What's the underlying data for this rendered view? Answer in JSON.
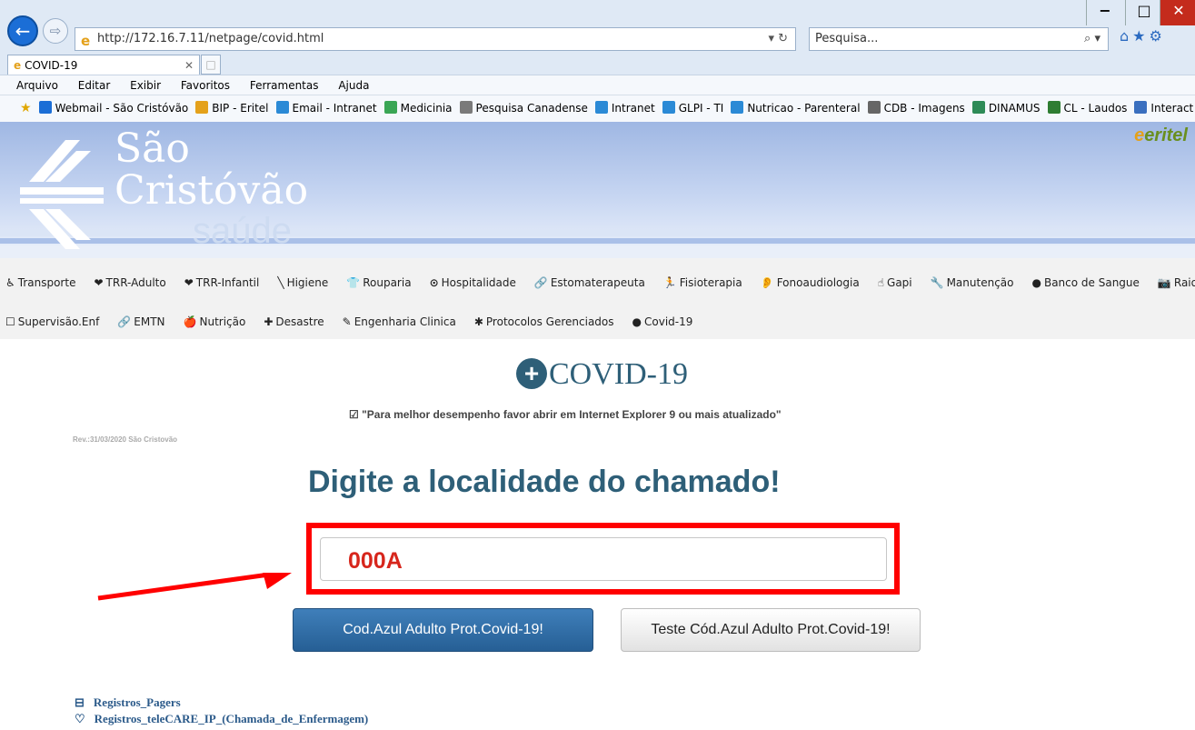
{
  "browser": {
    "url": "http://172.16.7.11/netpage/covid.html",
    "search_placeholder": "Pesquisa...",
    "tab_title": "COVID-19",
    "menu": [
      "Arquivo",
      "Editar",
      "Exibir",
      "Favoritos",
      "Ferramentas",
      "Ajuda"
    ],
    "favorites": [
      {
        "label": "Webmail - São Cristóvão",
        "color": "#1b6ed6"
      },
      {
        "label": "BIP - Eritel",
        "color": "#e4a11b"
      },
      {
        "label": "Email - Intranet",
        "color": "#2b8ad6"
      },
      {
        "label": "Medicinia",
        "color": "#3aa655"
      },
      {
        "label": "Pesquisa Canadense",
        "color": "#7a7a7a"
      },
      {
        "label": "Intranet",
        "color": "#2b8ad6"
      },
      {
        "label": "GLPI - TI",
        "color": "#2b8ad6"
      },
      {
        "label": "Nutricao - Parenteral",
        "color": "#2b8ad6"
      },
      {
        "label": "CDB - Imagens",
        "color": "#666666"
      },
      {
        "label": "DINAMUS",
        "color": "#2e8b57"
      },
      {
        "label": "CL - Laudos",
        "color": "#2e7d32"
      },
      {
        "label": "Interact",
        "color": "#3a6fbf"
      }
    ]
  },
  "banner": {
    "line1": "São",
    "line2": "Cristóvão",
    "line3": "saúde",
    "brand": "eritel",
    "brand_prefix": "e"
  },
  "nav": {
    "row1": [
      {
        "icon": "♿",
        "label": "Transporte"
      },
      {
        "icon": "❤",
        "label": "TRR-Adulto"
      },
      {
        "icon": "❤",
        "label": "TRR-Infantil"
      },
      {
        "icon": "╲",
        "label": "Higiene"
      },
      {
        "icon": "👕",
        "label": "Rouparia"
      },
      {
        "icon": "⊙",
        "label": "Hospitalidade"
      },
      {
        "icon": "🔗",
        "label": "Estomaterapeuta"
      },
      {
        "icon": "🏃",
        "label": "Fisioterapia"
      },
      {
        "icon": "👂",
        "label": "Fonoaudiologia"
      },
      {
        "icon": "☝",
        "label": "Gapi"
      },
      {
        "icon": "🔧",
        "label": "Manutenção"
      },
      {
        "icon": "●",
        "label": "Banco de Sangue"
      },
      {
        "icon": "📷",
        "label": "Raio X"
      }
    ],
    "row2": [
      {
        "icon": "☐",
        "label": "Supervisão.Enf"
      },
      {
        "icon": "🔗",
        "label": "EMTN"
      },
      {
        "icon": "🍎",
        "label": "Nutrição"
      },
      {
        "icon": "✚",
        "label": "Desastre"
      },
      {
        "icon": "✎",
        "label": "Engenharia Clinica"
      },
      {
        "icon": "✱",
        "label": "Protocolos Gerenciados"
      },
      {
        "icon": "●",
        "label": "Covid-19"
      }
    ]
  },
  "main": {
    "title": "COVID-19",
    "note": "\"Para melhor desempenho favor abrir em Internet Explorer 9 ou mais atualizado\"",
    "revision": "Rev.:31/03/2020 São Cristovão",
    "heading": "Digite a localidade do chamado!",
    "location_value": "000A",
    "primary_button": "Cod.Azul Adulto Prot.Covid-19!",
    "secondary_button": "Teste Cód.Azul Adulto Prot.Covid-19!",
    "links": [
      {
        "icon": "⊟",
        "label": "Registros_Pagers"
      },
      {
        "icon": "♡",
        "label": "Registros_teleCARE_IP_(Chamada_de_Enfermagem)"
      }
    ]
  },
  "colors": {
    "accent": "#2e5f78",
    "highlight": "#ff0000",
    "input_text": "#d7261c"
  }
}
